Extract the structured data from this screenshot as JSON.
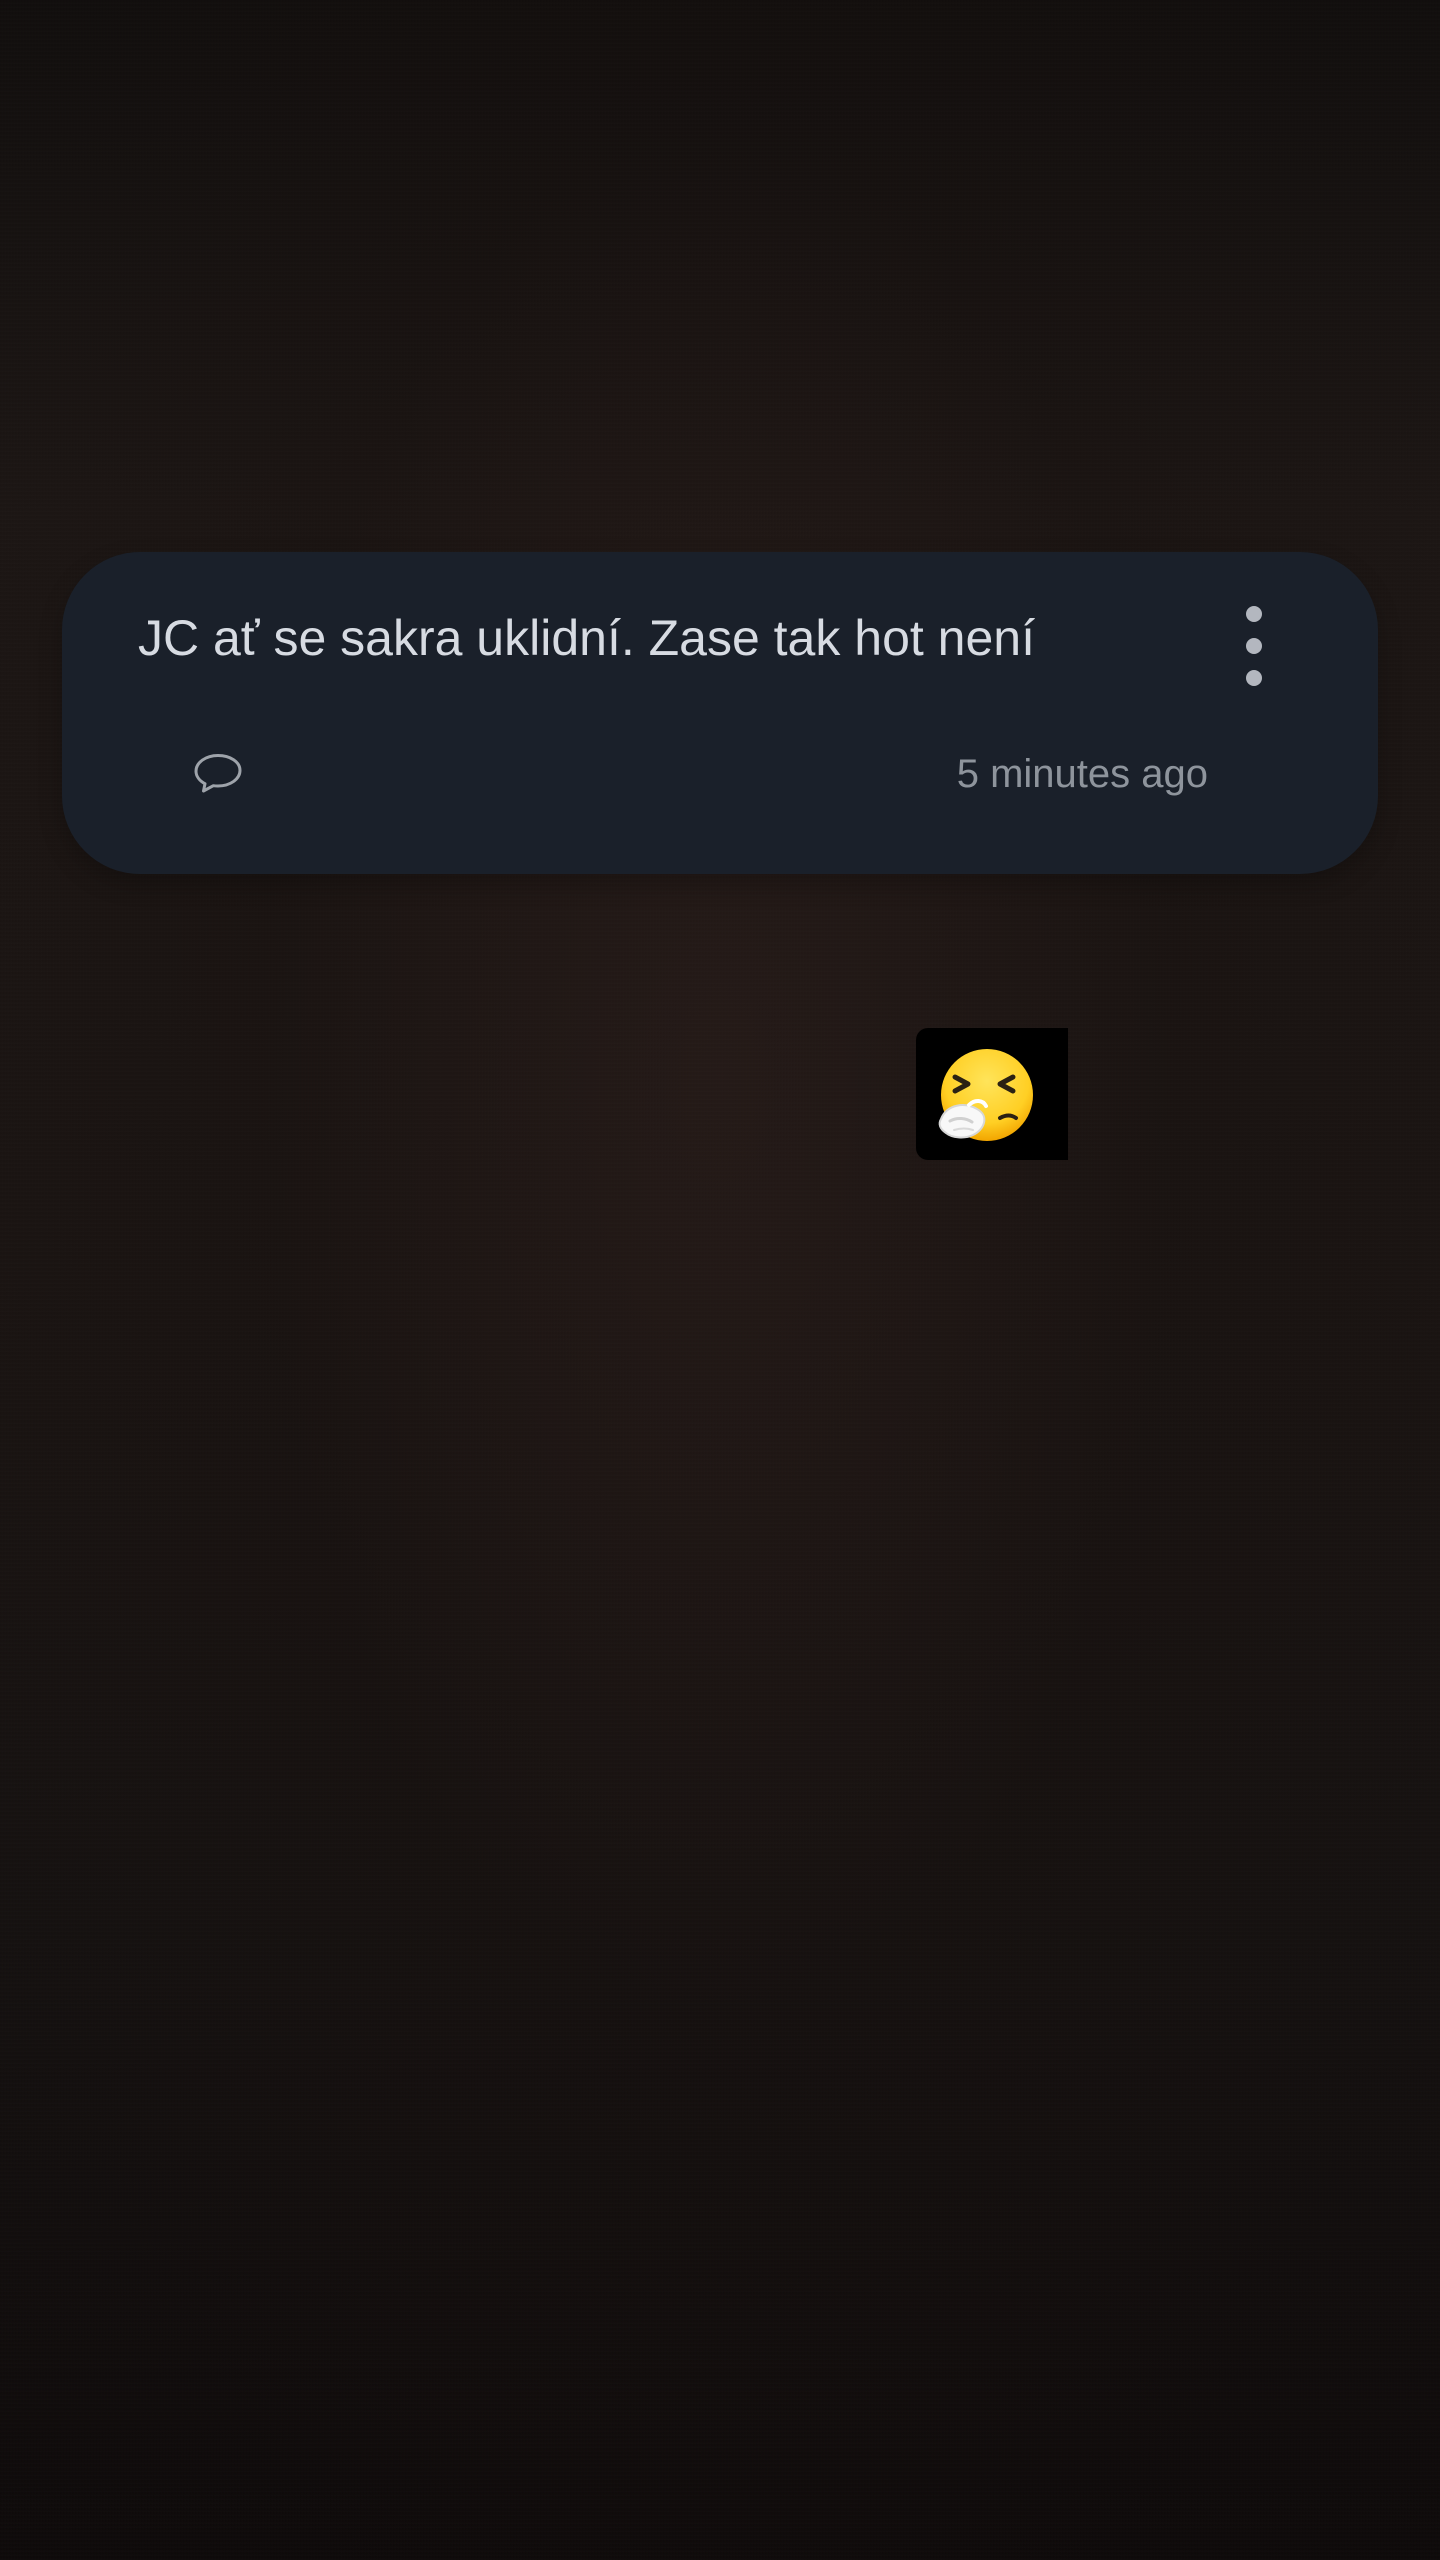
{
  "post": {
    "text": "JC ať se sakra uklidní. Zase tak hot není",
    "timestamp": "5 minutes ago",
    "actions": {
      "comment_icon": "comment-icon",
      "more_icon": "more-vertical-icon"
    }
  },
  "sticker": {
    "icon": "sneezing-face-emoji"
  },
  "colors": {
    "card_background": "#1a202a",
    "post_text": "#d7dbe2",
    "timestamp_text": "#8e949c",
    "icon_color": "#b3b7bf",
    "page_background": "#1b1513"
  }
}
